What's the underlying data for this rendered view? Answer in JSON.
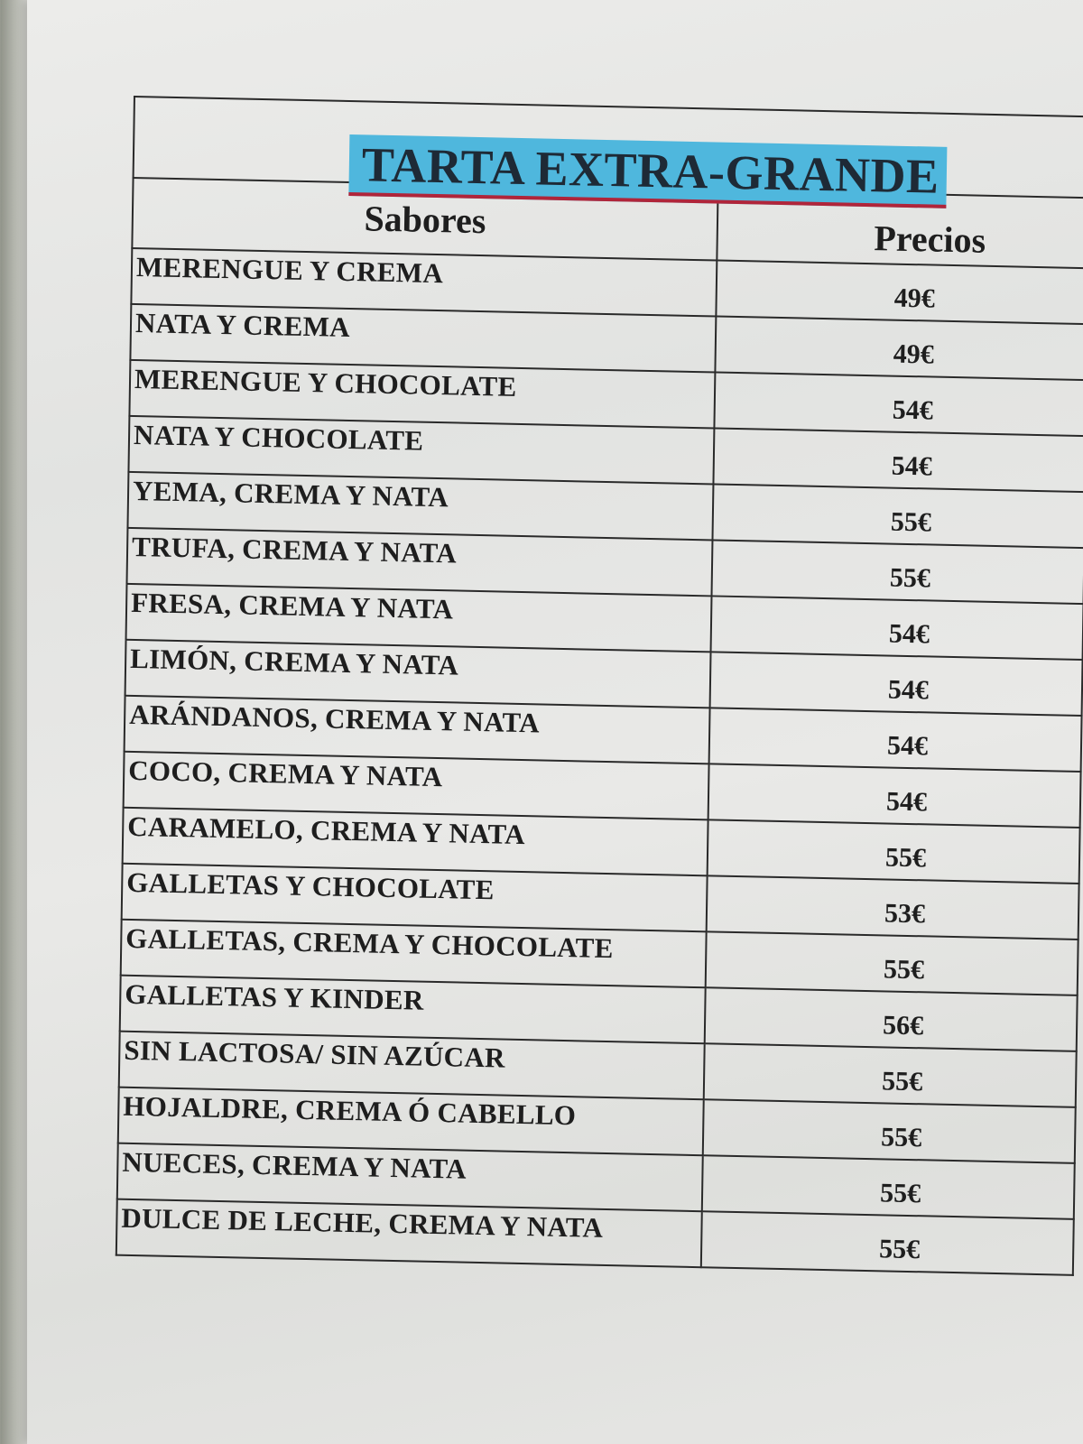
{
  "title": "TARTA EXTRA-GRANDE",
  "headers": {
    "flavor": "Sabores",
    "price": "Precios"
  },
  "rows": [
    {
      "flavor": "MERENGUE Y CREMA",
      "price": "49€"
    },
    {
      "flavor": "NATA Y CREMA",
      "price": "49€"
    },
    {
      "flavor": "MERENGUE Y CHOCOLATE",
      "price": "54€"
    },
    {
      "flavor": "NATA Y CHOCOLATE",
      "price": "54€"
    },
    {
      "flavor": "YEMA, CREMA Y NATA",
      "price": "55€"
    },
    {
      "flavor": "TRUFA, CREMA Y NATA",
      "price": "55€"
    },
    {
      "flavor": "FRESA, CREMA Y NATA",
      "price": "54€"
    },
    {
      "flavor": "LIMÓN, CREMA Y NATA",
      "price": "54€"
    },
    {
      "flavor": "ARÁNDANOS, CREMA Y NATA",
      "price": "54€"
    },
    {
      "flavor": "COCO, CREMA Y NATA",
      "price": "54€"
    },
    {
      "flavor": "CARAMELO, CREMA Y NATA",
      "price": "55€"
    },
    {
      "flavor": "GALLETAS Y CHOCOLATE",
      "price": "53€"
    },
    {
      "flavor": "GALLETAS, CREMA Y CHOCOLATE",
      "price": "55€"
    },
    {
      "flavor": "GALLETAS Y KINDER",
      "price": "56€"
    },
    {
      "flavor": "SIN LACTOSA/ SIN AZÚCAR",
      "price": "55€"
    },
    {
      "flavor": "HOJALDRE, CREMA Ó CABELLO",
      "price": "55€"
    },
    {
      "flavor": "NUECES, CREMA Y NATA",
      "price": "55€"
    },
    {
      "flavor": "DULCE DE LECHE, CREMA Y NATA",
      "price": "55€"
    }
  ],
  "colors": {
    "title_highlight": "#4fb7dd",
    "title_underline": "#b0253a",
    "paper": "#e6e6e4",
    "ink": "#1e1e1e"
  }
}
